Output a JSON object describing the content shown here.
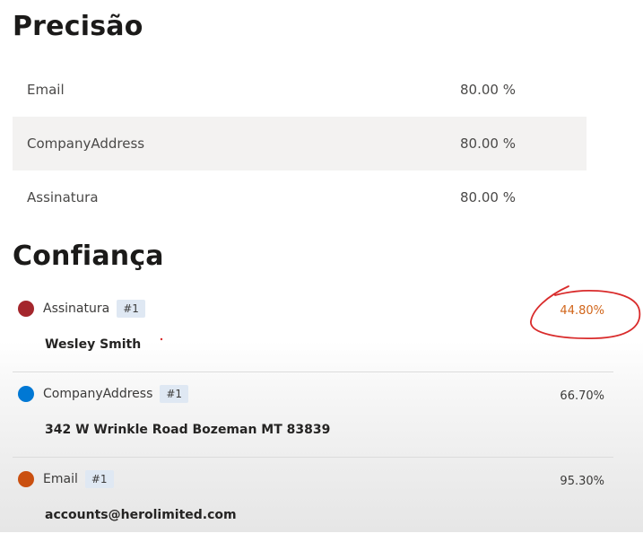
{
  "precision": {
    "title": "Precisão",
    "rows": [
      {
        "name": "Email",
        "value": "80.00 %"
      },
      {
        "name": "CompanyAddress",
        "value": "80.00 %"
      },
      {
        "name": "Assinatura",
        "value": "80.00 %"
      }
    ]
  },
  "confidence": {
    "title": "Confiança",
    "items": [
      {
        "label": "Assinatura",
        "badge": "#1",
        "value": "44.80%",
        "text": "Wesley Smith",
        "color": "#a4262c",
        "status": "low"
      },
      {
        "label": "CompanyAddress",
        "badge": "#1",
        "value": "66.70%",
        "text": "342 W Wrinkle Road Bozeman MT 83839",
        "color": "#0078d4",
        "status": "normal"
      },
      {
        "label": "Email",
        "badge": "#1",
        "value": "95.30%",
        "text": "accounts@herolimited.com",
        "color": "#ca5010",
        "status": "normal"
      }
    ]
  },
  "colors": {
    "annotation": "#d92b2b",
    "low_value": "#d1651a",
    "badge_bg": "#dfe8f3"
  }
}
